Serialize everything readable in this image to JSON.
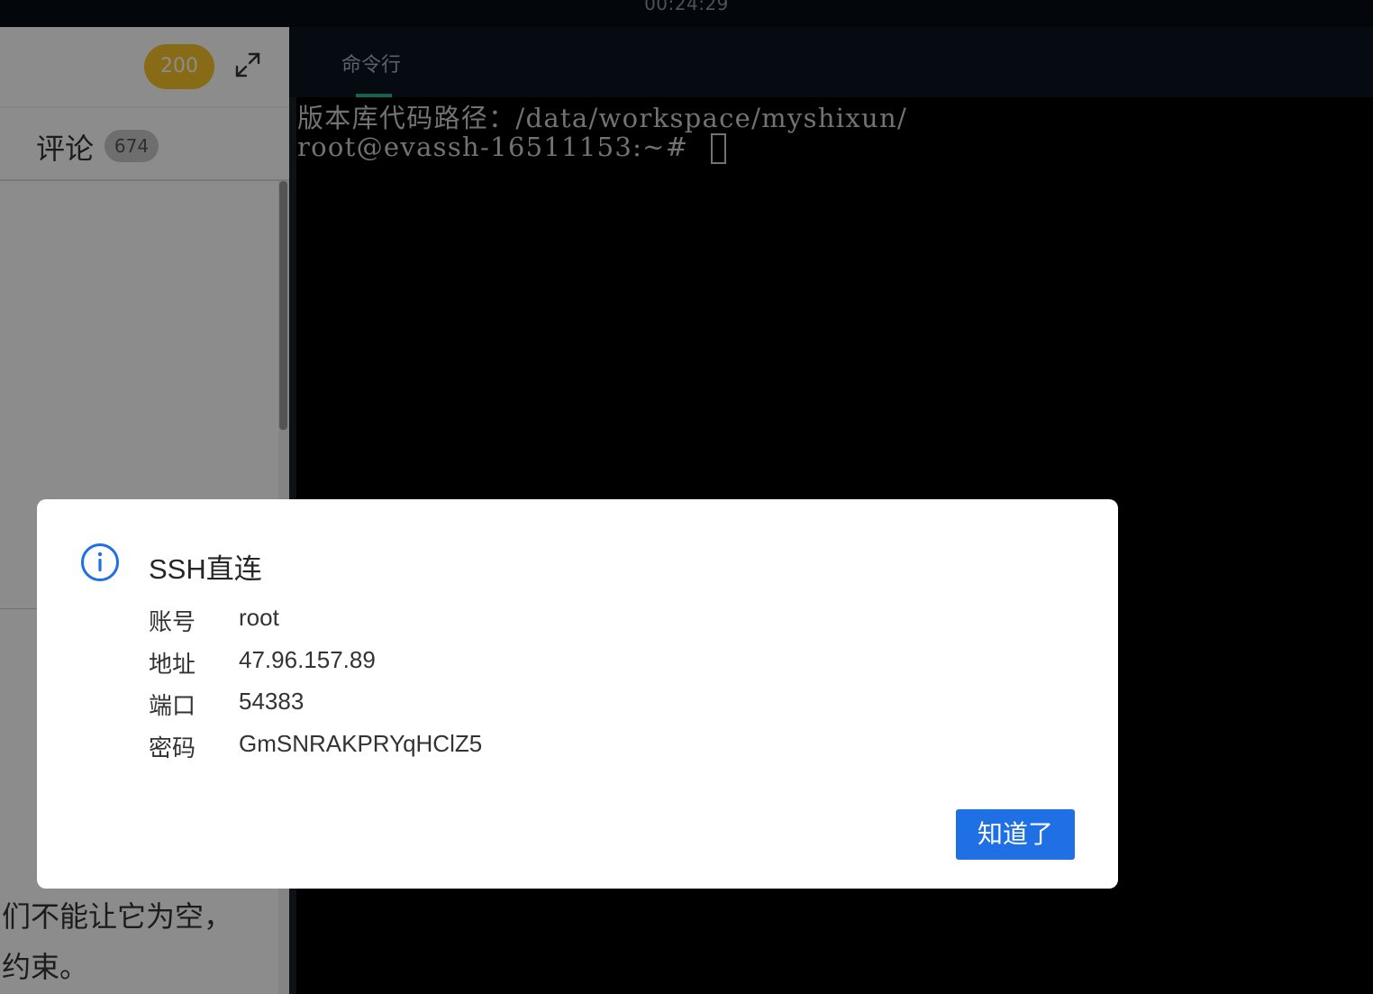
{
  "topbar": {
    "timer": "00:24:29"
  },
  "left_panel": {
    "score_badge": "200",
    "comment_tab": {
      "label": "评论",
      "count": "674"
    },
    "content_lines": [
      "们不能让它为空，",
      "约束。"
    ]
  },
  "terminal": {
    "tab_label": "命令行",
    "lines": [
      "版本库代码路径：/data/workspace/myshixun/",
      "root@evassh-16511153:~# "
    ]
  },
  "modal": {
    "title": "SSH直连",
    "fields": [
      {
        "label": "账号",
        "value": "root"
      },
      {
        "label": "地址",
        "value": "47.96.157.89"
      },
      {
        "label": "端口",
        "value": "54383"
      },
      {
        "label": "密码",
        "value": "GmSNRAKPRYqHClZ5"
      }
    ],
    "ok_button": "知道了"
  },
  "icons": {
    "info": "info-circle-icon",
    "expand": "expand-icon"
  },
  "colors": {
    "accent": "#1f6fe5",
    "badge": "#f8c42a",
    "terminal_tab_active": "#2fb58a"
  }
}
